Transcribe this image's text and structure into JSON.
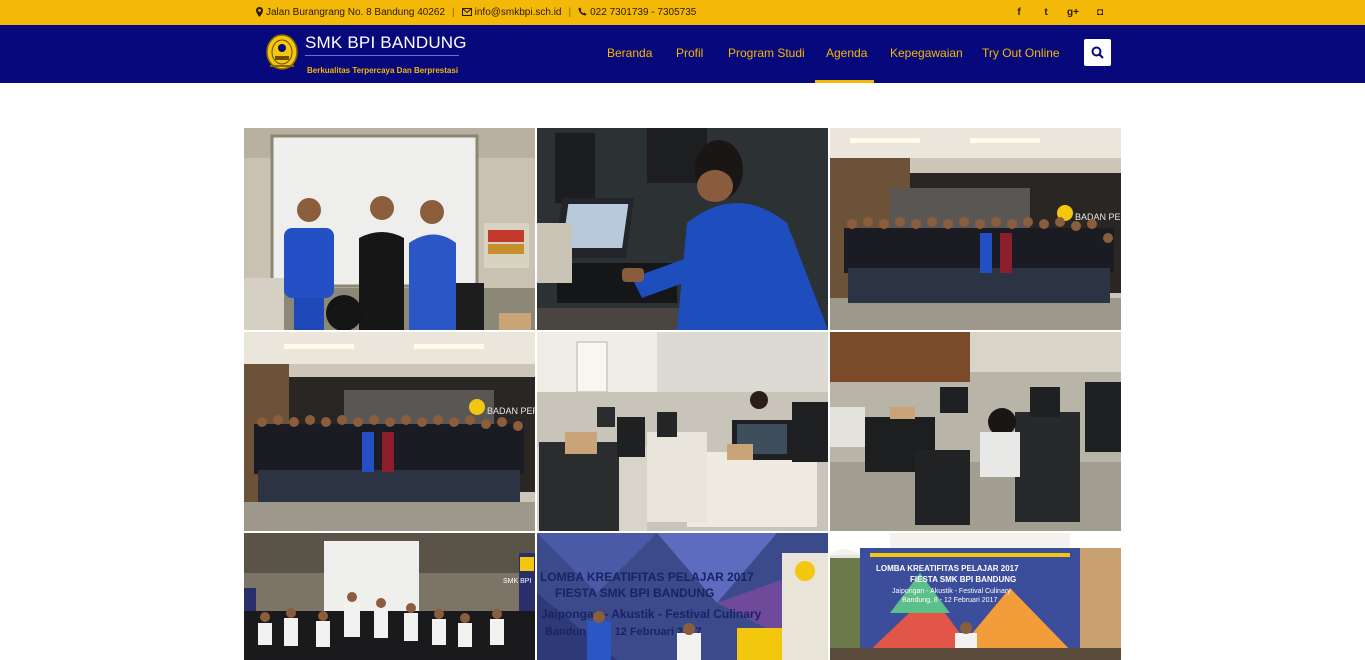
{
  "topbar": {
    "address": "Jalan Burangrang No. 8 Bandung 40262",
    "email": "info@smkbpi.sch.id",
    "phone": "022 7301739 - 7305735",
    "icons": [
      "map-marker-icon",
      "envelope-icon",
      "phone-icon"
    ],
    "social": [
      "facebook-icon",
      "twitter-icon",
      "google-plus-icon",
      "instagram-icon"
    ],
    "social_glyphs": [
      "f",
      "t",
      "g+",
      "◘"
    ]
  },
  "brand": {
    "title": "SMK BPI BANDUNG",
    "tagline": "Berkualitas Terpercaya Dan Berprestasi"
  },
  "nav": {
    "items": [
      "Beranda",
      "Profil",
      "Program Studi",
      "Agenda",
      "Kepegawaian",
      "Try Out Online"
    ],
    "active": "Agenda"
  },
  "colors": {
    "topbar": "#f3b808",
    "navbar": "#07087c",
    "accent": "#f3b808"
  },
  "gallery": {
    "photos": [
      {
        "subject": "three men in classroom"
      },
      {
        "subject": "student at computer"
      },
      {
        "subject": "group photo students"
      },
      {
        "subject": "group photo students"
      },
      {
        "subject": "computer lab"
      },
      {
        "subject": "computer lab students"
      },
      {
        "subject": "students group in hall"
      },
      {
        "subject": "Lomba Kreatifitas Pelajar 2017 banner"
      },
      {
        "subject": "Lomba Kreatifitas Pelajar 2017 stage"
      }
    ],
    "banner_text": {
      "line1": "LOMBA KREATIFITAS PELAJAR 2017",
      "line2": "FIESTA SMK BPI BANDUNG",
      "line3": "Jaipongan - Akustik - Festival Culinary",
      "line4": "Bandung, 8 - 12 Februari 2017"
    },
    "sign_text": "BADAN PERG",
    "badge_text": "SMK BPI"
  }
}
